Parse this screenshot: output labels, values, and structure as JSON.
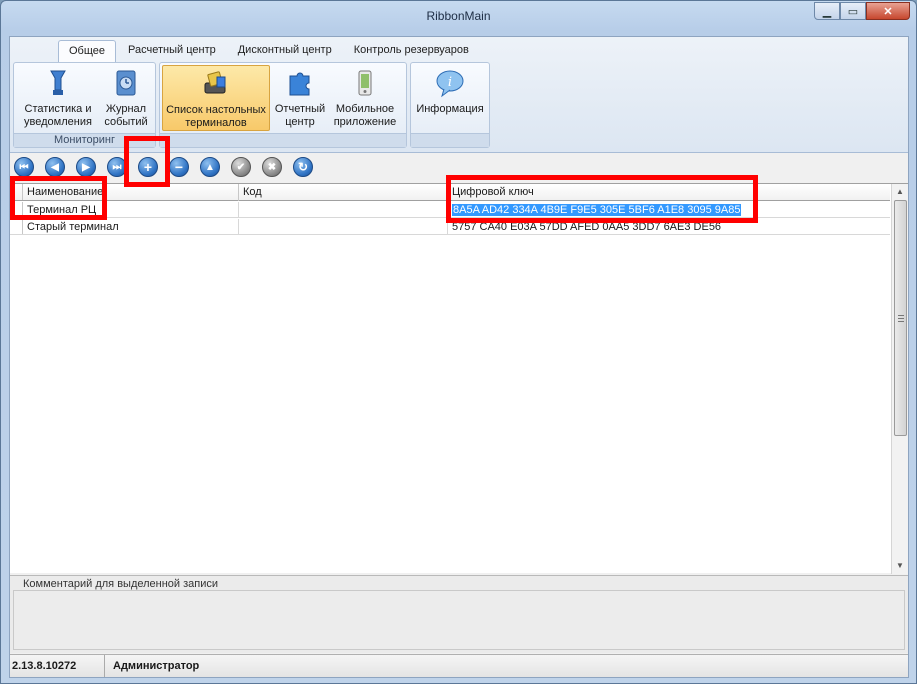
{
  "window": {
    "title": "RibbonMain",
    "minimize_icon": "minimize-icon",
    "maximize_icon": "maximize-icon",
    "close_icon": "close-icon"
  },
  "ribbon": {
    "tabs": [
      "Общее",
      "Расчетный центр",
      "Дисконтный центр",
      "Контроль резервуаров"
    ],
    "active_tab": "Общее",
    "groups": [
      {
        "label": "Мониторинг",
        "buttons": [
          {
            "label_line1": "Статистика и",
            "label_line2": "уведомления",
            "icon": "statistics-icon"
          },
          {
            "label_line1": "Журнал",
            "label_line2": "событий",
            "icon": "event-log-icon"
          }
        ]
      },
      {
        "label": "",
        "buttons": [
          {
            "label_line1": "Список настольных",
            "label_line2": "терминалов",
            "icon": "terminal-list-icon",
            "active": true
          },
          {
            "label_line1": "Отчетный",
            "label_line2": "центр",
            "icon": "puzzle-icon"
          },
          {
            "label_line1": "Мобильное",
            "label_line2": "приложение",
            "icon": "mobile-app-icon"
          }
        ]
      },
      {
        "label": "",
        "buttons": [
          {
            "label_line1": "Информация",
            "label_line2": "",
            "icon": "info-icon"
          }
        ]
      }
    ]
  },
  "nav_toolbar": {
    "buttons": [
      {
        "name": "first-record-button",
        "icon": "first-icon",
        "glyph": "⏮"
      },
      {
        "name": "prev-record-button",
        "icon": "prev-icon",
        "glyph": "◀"
      },
      {
        "name": "next-record-button",
        "icon": "next-icon",
        "glyph": "▶"
      },
      {
        "name": "last-record-button",
        "icon": "last-icon",
        "glyph": "⏭"
      },
      {
        "name": "add-record-button",
        "icon": "plus-icon",
        "glyph": "+"
      },
      {
        "name": "delete-record-button",
        "icon": "minus-icon",
        "glyph": "−"
      },
      {
        "name": "edit-record-button",
        "icon": "up-icon",
        "glyph": "▲"
      },
      {
        "name": "post-edit-button",
        "icon": "check-icon",
        "glyph": "✔"
      },
      {
        "name": "cancel-edit-button",
        "icon": "cancel-icon",
        "glyph": "✖"
      },
      {
        "name": "refresh-button",
        "icon": "refresh-icon",
        "glyph": "↻"
      }
    ]
  },
  "grid": {
    "columns": [
      "Наименование",
      "Код",
      "Цифровой ключ"
    ],
    "rows": [
      {
        "name": "Терминал РЦ",
        "code": "",
        "key": "8A5A AD42 334A 4B9E F9E5 305E 5BF6 A1E8 3095 9A85",
        "selected": true
      },
      {
        "name": "Старый терминал",
        "code": "",
        "key": "5757 CA40 E03A 57DD AFED 0AA5 3DD7 6AE3 DE56"
      }
    ]
  },
  "comment": {
    "label": "Комментарий для выделенной записи",
    "value": ""
  },
  "status": {
    "version": "2.13.8.10272",
    "user": "Администратор"
  },
  "colors": {
    "highlight": "#ff0000",
    "selection": "#3399ff",
    "accent_active": "#f8c96a"
  }
}
